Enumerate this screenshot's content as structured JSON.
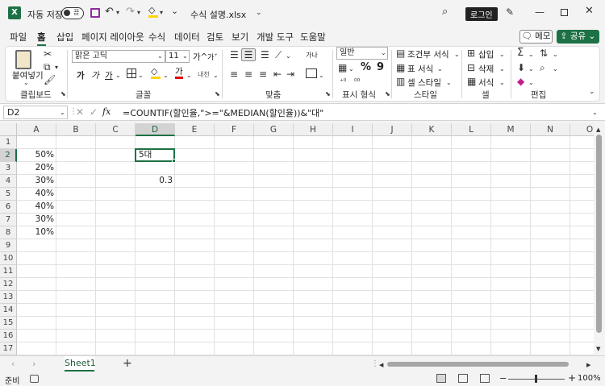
{
  "titlebar": {
    "app_icon": "X",
    "autosave_label": "자동 저장",
    "autosave_state": "끔",
    "file_name": "수식 설명.xlsx",
    "login_label": "로그인"
  },
  "menu": {
    "items": [
      "파일",
      "홈",
      "삽입",
      "페이지 레이아웃",
      "수식",
      "데이터",
      "검토",
      "보기",
      "개발 도구",
      "도움말"
    ],
    "active": "홈",
    "memo_label": "메모",
    "share_label": "공유"
  },
  "ribbon": {
    "groups": [
      "클립보드",
      "글꼴",
      "맞춤",
      "표시 형식",
      "스타일",
      "셀",
      "편집"
    ],
    "paste_label": "붙여넣기",
    "font_name": "맑은 고딕",
    "font_size": "11",
    "number_format": "일반",
    "conditional_format": "조건부 서식",
    "table_format": "표 서식",
    "cell_style": "셀 스타일",
    "insert": "삽입",
    "delete": "삭제",
    "format": "서식",
    "bold": "가",
    "italic": "가",
    "underline": "가",
    "grow_font": "가",
    "shrink_font": "가",
    "phonetic": "내천",
    "percent": "%",
    "comma": "9",
    "font_color": "가",
    "wrap": "가나"
  },
  "formula_bar": {
    "name_box": "D2",
    "fx": "fx",
    "formula": "=COUNTIF(할인율,\">=\"&MEDIAN(할인율))&\"대\""
  },
  "grid": {
    "columns": [
      "A",
      "B",
      "C",
      "D",
      "E",
      "F",
      "G",
      "H",
      "I",
      "J",
      "K",
      "L",
      "M",
      "N",
      "O"
    ],
    "rows": [
      "1",
      "2",
      "3",
      "4",
      "5",
      "6",
      "7",
      "8",
      "9",
      "10",
      "11",
      "12",
      "13",
      "14",
      "15",
      "16",
      "17"
    ],
    "selected_column": "D",
    "selected_row": "2",
    "cells": {
      "A2": "50%",
      "A3": "20%",
      "A4": "30%",
      "A5": "40%",
      "A6": "40%",
      "A7": "30%",
      "A8": "10%",
      "D2": "5대",
      "D4": "0.3"
    }
  },
  "sheets": {
    "tabs": [
      "Sheet1"
    ],
    "add": "+"
  },
  "status": {
    "ready": "준비",
    "zoom": "100%",
    "minus": "−",
    "plus": "+"
  },
  "colors": {
    "accent": "#1e7145",
    "grid_line": "#e1e1e1"
  }
}
